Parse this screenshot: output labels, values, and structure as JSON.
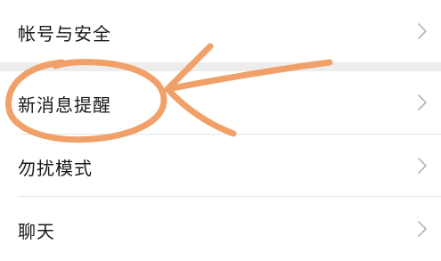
{
  "settings_list": {
    "items": [
      {
        "label": "帐号与安全",
        "chevron": "chevron-right-icon"
      },
      {
        "label": "新消息提醒",
        "chevron": "chevron-right-icon"
      },
      {
        "label": "勿扰模式",
        "chevron": "chevron-right-icon"
      },
      {
        "label": "聊天",
        "chevron": "chevron-right-icon"
      }
    ]
  },
  "colors": {
    "background": "#ffffff",
    "section_gap": "#ededed",
    "divider": "#e6e6e6",
    "text": "#1a1a1a",
    "chevron": "#b5b5b5",
    "annotation": "#f0a068"
  }
}
